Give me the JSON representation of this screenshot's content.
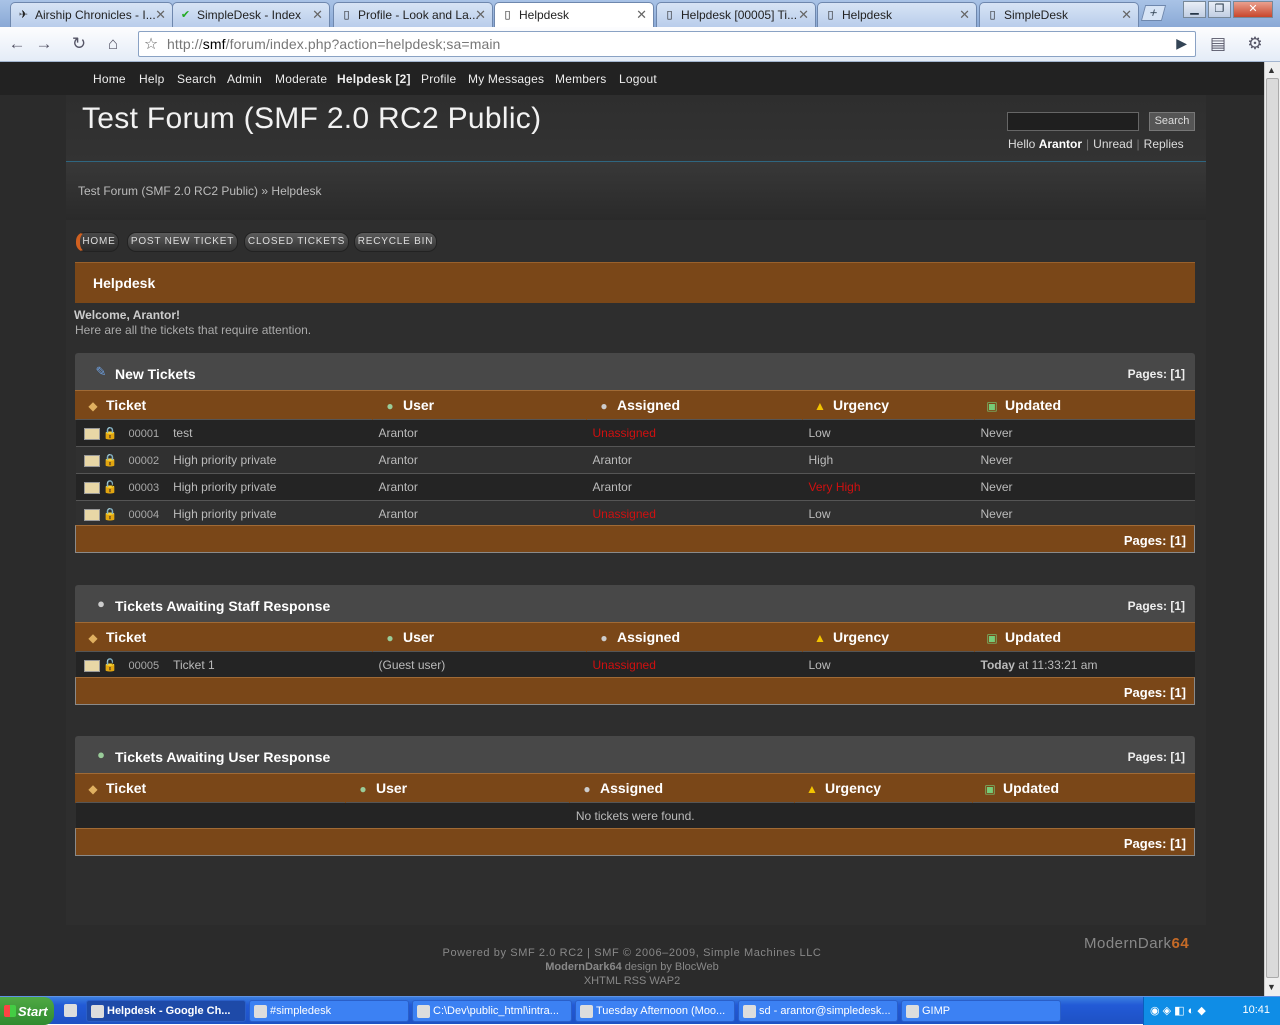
{
  "browser": {
    "tabs": [
      {
        "title": "Airship Chronicles - I...",
        "active": false
      },
      {
        "title": "SimpleDesk - Index",
        "active": false
      },
      {
        "title": "Profile - Look and La...",
        "active": false
      },
      {
        "title": "Helpdesk",
        "active": true
      },
      {
        "title": "Helpdesk [00005] Ti...",
        "active": false
      },
      {
        "title": "Helpdesk",
        "active": false
      },
      {
        "title": "SimpleDesk",
        "active": false
      }
    ],
    "url_prefix": "http://",
    "url_host": "smf",
    "url_rest": "/forum/index.php?action=helpdesk;sa=main"
  },
  "forum": {
    "nav": [
      "Home",
      "Help",
      "Search",
      "Admin",
      "Moderate",
      "Helpdesk [2]",
      "Profile",
      "My Messages",
      "Members",
      "Logout"
    ],
    "title": "Test Forum (SMF 2.0 RC2 Public)",
    "search_button": "Search",
    "hello": "Hello",
    "username": "Arantor",
    "unread": "Unread",
    "replies": "Replies",
    "breadcrumb_root": "Test Forum (SMF 2.0 RC2 Public)",
    "breadcrumb_sep": "»",
    "breadcrumb_current": "Helpdesk",
    "buttons": [
      "HOME",
      "POST NEW TICKET",
      "CLOSED TICKETS",
      "RECYCLE BIN"
    ],
    "section_title": "Helpdesk",
    "welcome": "Welcome, Arantor!",
    "welcome_sub": "Here are all the tickets that require attention."
  },
  "columns": {
    "ticket": "Ticket",
    "user": "User",
    "assigned": "Assigned",
    "urgency": "Urgency",
    "updated": "Updated"
  },
  "pages_label": "Pages: [1]",
  "new_tickets": {
    "title": "New Tickets",
    "rows": [
      {
        "id": "00001",
        "subject": "test",
        "user": "Arantor",
        "assigned": "Unassigned",
        "urgency": "Low",
        "updated": "Never"
      },
      {
        "id": "00002",
        "subject": "High priority private",
        "user": "Arantor",
        "assigned": "Arantor",
        "urgency": "High",
        "updated": "Never"
      },
      {
        "id": "00003",
        "subject": "High priority private",
        "user": "Arantor",
        "assigned": "Arantor",
        "urgency": "Very High",
        "updated": "Never"
      },
      {
        "id": "00004",
        "subject": "High priority private",
        "user": "Arantor",
        "assigned": "Unassigned",
        "urgency": "Low",
        "updated": "Never"
      }
    ]
  },
  "staff_response": {
    "title": "Tickets Awaiting Staff Response",
    "rows": [
      {
        "id": "00005",
        "subject": "Ticket 1",
        "user": "(Guest user)",
        "assigned": "Unassigned",
        "urgency": "Low",
        "updated_bold": "Today",
        "updated": " at 11:33:21 am"
      }
    ]
  },
  "user_response": {
    "title": "Tickets Awaiting User Response",
    "empty": "No tickets were found."
  },
  "footer": {
    "line1": "Powered by SMF 2.0 RC2 | SMF © 2006–2009, Simple Machines LLC",
    "line2_bold": "ModernDark64",
    "line2_rest": " design by BlocWeb",
    "line3": "XHTML RSS WAP2",
    "logo_main": "ModernDark",
    "logo_num": "64"
  },
  "taskbar": {
    "start": "Start",
    "items": [
      "Helpdesk - Google Ch...",
      "#simpledesk",
      "C:\\Dev\\public_html\\intra...",
      "Tuesday Afternoon (Moo...",
      "sd - arantor@simpledesk...",
      "GIMP"
    ],
    "clock": "10:41"
  },
  "colors": {
    "accent": "#7a4718",
    "unassigned": "#d01010",
    "bg": "#2b2b2b"
  }
}
